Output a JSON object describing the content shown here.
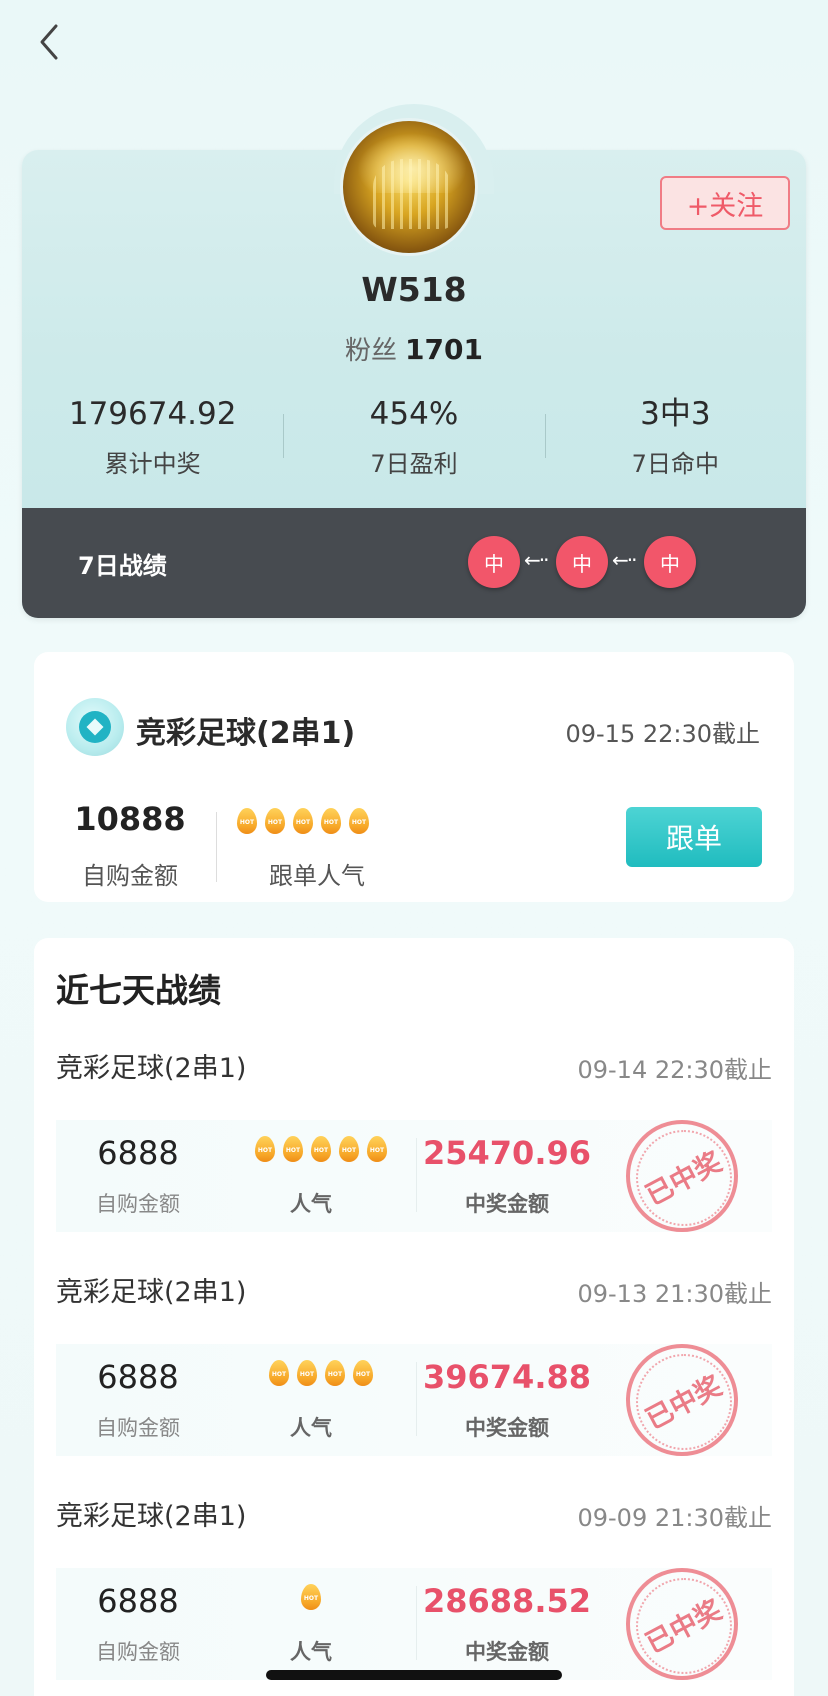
{
  "profile": {
    "follow_label": "+关注",
    "username": "W518",
    "fans_label": "粉丝",
    "fans_count": "1701",
    "stats": [
      {
        "value": "179674.92",
        "label": "累计中奖"
      },
      {
        "value": "454%",
        "label": "7日盈利"
      },
      {
        "value": "3中3",
        "label": "7日命中"
      }
    ],
    "record_label": "7日战绩",
    "record_hits": [
      "中",
      "中",
      "中"
    ]
  },
  "current_bet": {
    "title": "竞彩足球(2串1)",
    "deadline": "09-15 22:30截止",
    "amount": "10888",
    "amount_label": "自购金额",
    "popularity": 5,
    "popularity_label": "跟单人气",
    "follow_button": "跟单"
  },
  "history": {
    "heading": "近七天战绩",
    "records": [
      {
        "title": "竞彩足球(2串1)",
        "deadline": "09-14 22:30截止",
        "amount": "6888",
        "amount_label": "自购金额",
        "popularity": 5,
        "popularity_label": "人气",
        "win": "25470.96",
        "win_label": "中奖金额",
        "stamp": "已中奖"
      },
      {
        "title": "竞彩足球(2串1)",
        "deadline": "09-13 21:30截止",
        "amount": "6888",
        "amount_label": "自购金额",
        "popularity": 4,
        "popularity_label": "人气",
        "win": "39674.88",
        "win_label": "中奖金额",
        "stamp": "已中奖"
      },
      {
        "title": "竞彩足球(2串1)",
        "deadline": "09-09 21:30截止",
        "amount": "6888",
        "amount_label": "自购金额",
        "popularity": 1,
        "popularity_label": "人气",
        "win": "28688.52",
        "win_label": "中奖金额",
        "stamp": "已中奖"
      }
    ]
  },
  "colors": {
    "accent": "#20bcbf",
    "win": "#e8516a",
    "hit": "#f2566a"
  }
}
